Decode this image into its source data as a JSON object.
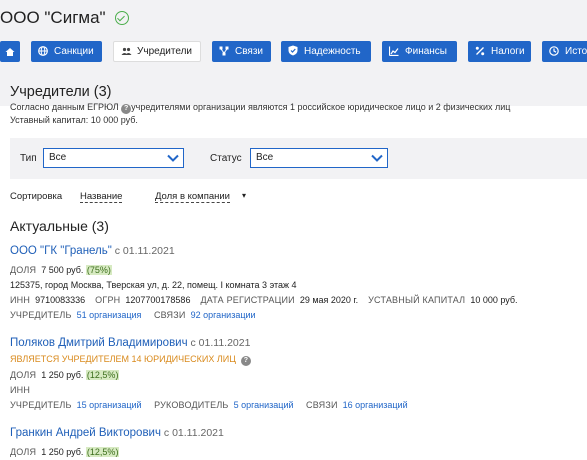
{
  "header": {
    "title": "ООО \"Сигма\""
  },
  "tabs": [
    {
      "label": "",
      "icon": "home-icon"
    },
    {
      "label": "Санкции",
      "icon": "globe-icon"
    },
    {
      "label": "Учредители",
      "icon": "people-icon",
      "active": true
    },
    {
      "label": "Связи",
      "icon": "links-icon"
    },
    {
      "label": "Надежность",
      "icon": "shield-icon"
    },
    {
      "label": "Финансы",
      "icon": "chart-icon"
    },
    {
      "label": "Налоги",
      "icon": "percent-icon"
    },
    {
      "label": "Исто",
      "icon": "history-icon"
    }
  ],
  "section": {
    "title": "Учредители (3)",
    "desc_before": "Согласно данным ЕГРЮЛ ",
    "desc_after": "учредителями организации являются 1 российское юридическое лицо и 2 физических лиц",
    "capital": "Уставный капитал: 10 000 руб."
  },
  "filter": {
    "type_label": "Тип",
    "type_value": "Все",
    "status_label": "Статус",
    "status_value": "Все"
  },
  "sort": {
    "label": "Сортировка",
    "opt1": "Название",
    "opt2": "Доля в компании",
    "caret": "▾"
  },
  "actual": {
    "title": "Актуальные (3)"
  },
  "e1": {
    "name": "ООО \"ГК \"Гранель\"",
    "since": " с 01.11.2021",
    "share_label": "ДОЛЯ",
    "share_value": "7 500 руб.",
    "share_pct": "(75%)",
    "address": "125375, город Москва, Тверская ул, д. 22, помещ. I комната 3 этаж 4",
    "inn_label": "ИНН",
    "inn": "9710083336",
    "ogrn_label": "ОГРН",
    "ogrn": "1207700178586",
    "reg_label": "ДАТА РЕГИСТРАЦИИ",
    "reg": "29 мая 2020 г.",
    "cap_label": "УСТАВНЫЙ КАПИТАЛ",
    "cap": "10 000 руб.",
    "founder_label": "УЧРЕДИТЕЛЬ",
    "founder_link": "51 организация",
    "links_label": "СВЯЗИ",
    "links_link": "92 организации"
  },
  "e2": {
    "name": "Поляков Дмитрий Владимирович",
    "since": " с 01.11.2021",
    "note": "ЯВЛЯЕТСЯ УЧРЕДИТЕЛЕМ 14 ЮРИДИЧЕСКИХ ЛИЦ",
    "share_label": "ДОЛЯ",
    "share_value": "1 250 руб.",
    "share_pct": "(12,5%)",
    "inn_label": "ИНН",
    "founder_label": "УЧРЕДИТЕЛЬ",
    "founder_link": "15 организаций",
    "head_label": "РУКОВОДИТЕЛЬ",
    "head_link": "5 организаций",
    "links_label": "СВЯЗИ",
    "links_link": "16 организаций"
  },
  "e3": {
    "name": "Гранкин Андрей Викторович",
    "since": " с 01.11.2021",
    "share_label": "ДОЛЯ",
    "share_value": "1 250 руб.",
    "share_pct": "(12,5%)"
  },
  "colors": {
    "accent": "#2166c8",
    "ok": "#4cae4c",
    "badge_bg": "#d7eac2",
    "warning": "#d98a1c"
  }
}
